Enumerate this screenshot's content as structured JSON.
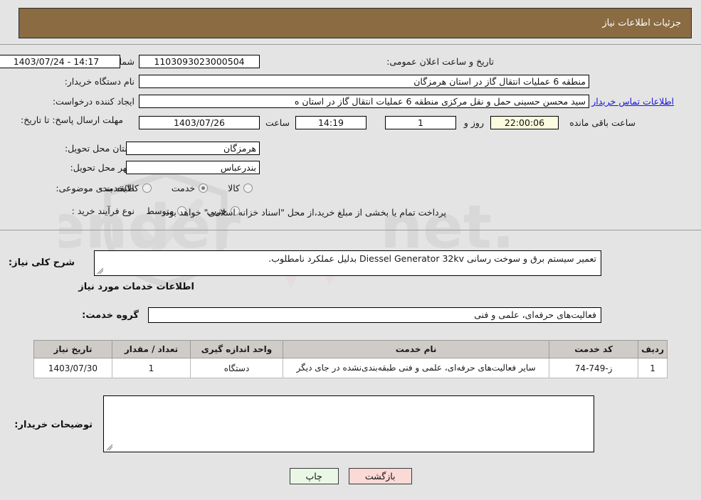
{
  "header": {
    "title": "جزئیات اطلاعات نیاز"
  },
  "form": {
    "need_number_label": "شماره نیاز:",
    "need_number_value": "1103093023000504",
    "announce_label": "تاریخ و ساعت اعلان عمومی:",
    "announce_value": "14:17 - 1403/07/24",
    "buyer_org_label": "نام دستگاه خریدار:",
    "buyer_org_value": "منطقه 6 عملیات انتقال گاز در استان هرمزگان",
    "requester_label": "ایجاد کننده درخواست:",
    "requester_value": "سید محسن حسینی حمل و نقل مرکزی منطقه 6 عملیات انتقال گاز در استان ه",
    "contact_link": "اطلاعات تماس خریدار",
    "deadline_label": "مهلت ارسال پاسخ: تا تاریخ:",
    "deadline_date": "1403/07/26",
    "hour_label": "ساعت",
    "deadline_time": "14:19",
    "days_value": "1",
    "days_label": "روز و",
    "countdown_value": "22:00:06",
    "remaining_label": "ساعت باقی مانده",
    "province_label": "استان محل تحویل:",
    "province_value": "هرمزگان",
    "city_label": "شهر محل تحویل:",
    "city_value": "بندرعباس",
    "category_label": "طبقه بندی موضوعی:",
    "category_options": [
      {
        "label": "کالا",
        "selected": false
      },
      {
        "label": "خدمت",
        "selected": true
      },
      {
        "label": "کالا/خدمت",
        "selected": false
      }
    ],
    "process_label": "نوع فرآیند خرید :",
    "process_options": [
      {
        "label": "جزیی",
        "selected": false
      },
      {
        "label": "متوسط",
        "selected": false
      }
    ],
    "treasury_note": "پرداخت تمام یا بخشی از مبلغ خرید،از محل \"اسناد خزانه اسلامی\" خواهد بود."
  },
  "summary": {
    "label": "شرح کلی نیاز:",
    "value": "تعمیر سیستم برق و سوخت رسانی Diessel Generator 32kv بدلیل عملکرد نامطلوب."
  },
  "services_section": {
    "heading": "اطلاعات خدمات مورد نیاز",
    "group_label": "گروه خدمت:",
    "group_value": "فعالیت‌های حرفه‌ای، علمی و فنی"
  },
  "table": {
    "columns": [
      "ردیف",
      "کد خدمت",
      "نام خدمت",
      "واحد اندازه گیری",
      "تعداد / مقدار",
      "تاریخ نیاز"
    ],
    "rows": [
      {
        "row_no": "1",
        "service_code": "ز-749-74",
        "service_name": "سایر فعالیت‌های حرفه‌ای، علمی و فنی طبقه‌بندی‌نشده در جای دیگر",
        "unit": "دستگاه",
        "quantity": "1",
        "need_date": "1403/07/30"
      }
    ]
  },
  "buyer_notes": {
    "label": "توضیحات خریدار:",
    "value": ""
  },
  "footer": {
    "print_label": "چاپ",
    "back_label": "بازگشت"
  },
  "watermark": {
    "text": "AriaTender.net"
  }
}
